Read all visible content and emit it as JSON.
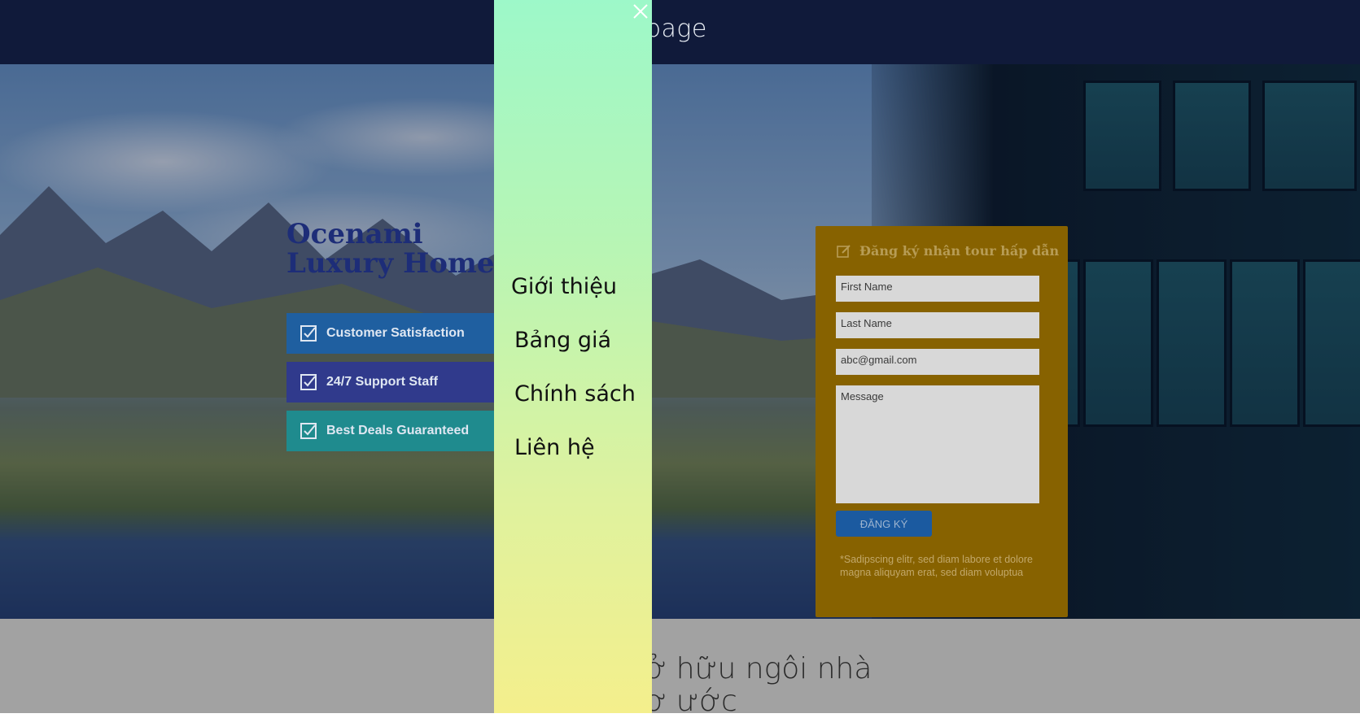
{
  "header": {
    "brand_visible_fragment": "page"
  },
  "hero": {
    "headline_line1": "Ocenami",
    "headline_line2": "Luxury Home a",
    "features": [
      {
        "label": "Customer Satisfaction",
        "icon": "checkbox-icon"
      },
      {
        "label": "24/7 Support Staff",
        "icon": "checkbox-icon"
      },
      {
        "label": "Best Deals Guaranteed",
        "icon": "checkbox-icon"
      }
    ]
  },
  "form": {
    "title": "Đăng ký nhận tour hấp dẫn",
    "title_icon": "edit-icon",
    "first_name_placeholder": "First Name",
    "last_name_placeholder": "Last Name",
    "email_placeholder": "abc@gmail.com",
    "message_placeholder": "Message",
    "submit_label": "ĐĂNG KÝ",
    "note": "*Sadipscing elitr, sed diam labore et dolore magna aliquyam erat, sed diam voluptua"
  },
  "lower": {
    "title_line1": "ở hữu ngôi nhà",
    "title_line2": "ơ ước"
  },
  "drawer": {
    "close_icon": "close-icon",
    "menu": [
      "Giới thiệu",
      "Bảng giá",
      "Chính sách",
      "Liên hệ"
    ]
  },
  "colors": {
    "topbar": "#101a3a",
    "form_background": "#876200",
    "submit_button": "#1b5aa0",
    "drawer_gradient_top": "#9df8c9",
    "drawer_gradient_bottom": "#f4ef8c",
    "headline": "#1d2d78"
  }
}
